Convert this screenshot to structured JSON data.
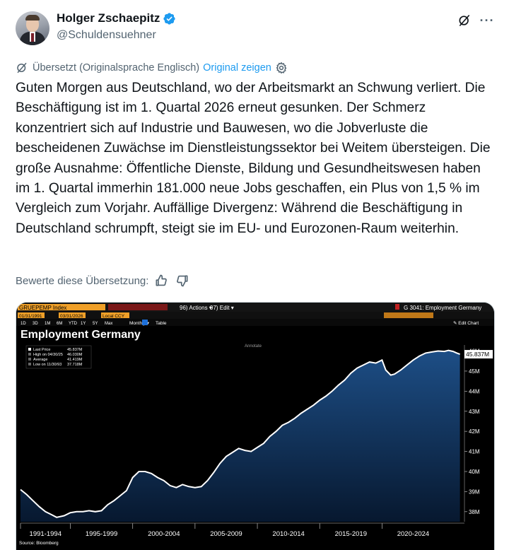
{
  "author": {
    "display_name": "Holger Zschaepitz",
    "handle": "@Schuldensuehner",
    "verified_color": "#1d9bf0"
  },
  "header_icons": {
    "grok": "grok-icon",
    "more": "more-icon",
    "more_glyph": "···"
  },
  "translation": {
    "notice": "Übersetzt (Originalsprache Englisch)",
    "show_original": "Original zeigen"
  },
  "tweet_text": "Guten Morgen aus Deutschland, wo der Arbeitsmarkt an Schwung verliert. Die Beschäftigung ist im 1. Quartal 2026 erneut gesunken. Der Schmerz konzentriert sich auf Industrie und Bauwesen, wo die Jobverluste die bescheidenen Zuwächse im Dienstleistungssektor bei Weitem übersteigen. Die große Ausnahme: Öffentliche Dienste, Bildung und Gesundheitswesen haben im 1. Quartal immerhin 181.000 neue Jobs geschaffen, ein Plus von 1,5 % im Vergleich zum Vorjahr. Auffällige Divergenz: Während die Beschäftigung in Deutschland schrumpft, steigt sie im EU- und Eurozonen-Raum weiterhin.",
  "rating": {
    "label": "Bewerte diese Übersetzung:"
  },
  "terminal": {
    "ticker": "GRUEPEMP Index",
    "actions": "96) Actions ▾",
    "edit": "97) Edit ▾",
    "page_title": "G 3041: Employment Germany",
    "start_date": "01/31/1991",
    "end_date": "03/31/2026",
    "currency": "Local CCY",
    "periods": [
      "1D",
      "3D",
      "1M",
      "6M",
      "YTD",
      "1Y",
      "5Y",
      "Max"
    ],
    "frequency": "Monthly ▾",
    "table": "Table",
    "edit_chart": "✎ Edit Chart",
    "annotate": "Annotate",
    "source": "Source: Bloomberg"
  },
  "chart_data": {
    "type": "area",
    "title": "Employment Germany",
    "legend": [
      {
        "label": "Last Price",
        "value": "45.837M"
      },
      {
        "label": "High on 04/30/25",
        "value": "46.030M"
      },
      {
        "label": "Average",
        "value": "41.419M"
      },
      {
        "label": "Low on 11/30/93",
        "value": "37.718M"
      }
    ],
    "last_value_label": "45.837M",
    "x_tick_labels": [
      "1991-1994",
      "1995-1999",
      "2000-2004",
      "2005-2009",
      "2010-2014",
      "2015-2019",
      "2020-2024"
    ],
    "y_tick_labels": [
      "46M",
      "45M",
      "44M",
      "43M",
      "42M",
      "41M",
      "40M",
      "39M",
      "38M"
    ],
    "ylim": [
      37.5,
      46.3
    ],
    "xlim": [
      1991.0,
      2026.5
    ],
    "series": [
      {
        "x": [
          1991.0,
          1991.5,
          1992.0,
          1992.5,
          1993.0,
          1993.5,
          1993.9,
          1994.5,
          1995.0,
          1995.5,
          1996.0,
          1996.5,
          1997.0,
          1997.5,
          1998.0,
          1998.5,
          1999.0,
          1999.5,
          2000.0,
          2000.5,
          2001.0,
          2001.5,
          2002.0,
          2002.5,
          2003.0,
          2003.5,
          2004.0,
          2004.5,
          2005.0,
          2005.5,
          2006.0,
          2006.5,
          2007.0,
          2007.5,
          2008.0,
          2008.5,
          2009.0,
          2009.5,
          2010.0,
          2010.5,
          2011.0,
          2011.5,
          2012.0,
          2012.5,
          2013.0,
          2013.5,
          2014.0,
          2014.5,
          2015.0,
          2015.5,
          2016.0,
          2016.5,
          2017.0,
          2017.5,
          2018.0,
          2018.5,
          2019.0,
          2019.5,
          2020.0,
          2020.3,
          2020.7,
          2021.0,
          2021.5,
          2022.0,
          2022.5,
          2023.0,
          2023.5,
          2024.0,
          2024.5,
          2025.0,
          2025.33,
          2025.7,
          2026.0,
          2026.25
        ],
        "values": [
          39.1,
          38.85,
          38.55,
          38.25,
          38.0,
          37.85,
          37.72,
          37.8,
          37.95,
          38.0,
          38.0,
          38.05,
          38.0,
          38.05,
          38.35,
          38.55,
          38.8,
          39.05,
          39.7,
          40.0,
          40.0,
          39.9,
          39.7,
          39.55,
          39.3,
          39.2,
          39.35,
          39.25,
          39.2,
          39.25,
          39.55,
          39.95,
          40.4,
          40.75,
          40.95,
          41.15,
          41.05,
          41.0,
          41.2,
          41.4,
          41.75,
          42.0,
          42.3,
          42.45,
          42.65,
          42.9,
          43.1,
          43.3,
          43.55,
          43.75,
          44.0,
          44.3,
          44.55,
          44.9,
          45.15,
          45.3,
          45.45,
          45.4,
          45.55,
          45.05,
          44.8,
          44.85,
          45.05,
          45.3,
          45.55,
          45.75,
          45.9,
          45.95,
          46.0,
          45.98,
          46.03,
          45.98,
          45.9,
          45.84
        ]
      }
    ],
    "colors": {
      "line": "#ffffff",
      "fill_top": "#1d4e86",
      "fill_bottom": "#07182f",
      "last_label_bg": "#ffffff"
    }
  }
}
